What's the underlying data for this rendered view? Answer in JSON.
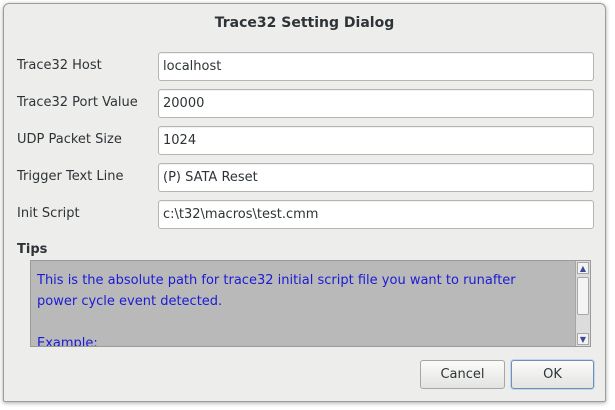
{
  "dialog": {
    "title": "Trace32 Setting Dialog"
  },
  "fields": [
    {
      "label": "Trace32 Host",
      "value": "localhost"
    },
    {
      "label": "Trace32 Port Value",
      "value": "20000"
    },
    {
      "label": "UDP Packet Size",
      "value": "1024"
    },
    {
      "label": "Trigger Text Line",
      "value": "(P) SATA Reset"
    },
    {
      "label": "Init Script",
      "value": "c:\\t32\\macros\\test.cmm"
    }
  ],
  "tips": {
    "label": "Tips",
    "text": "This is the absolute path for trace32 initial script file you want to runafter\npower cycle event detected.\n\nExample:",
    "text_color": "#1b1bd6"
  },
  "buttons": {
    "cancel_label": "Cancel",
    "ok_label": "OK"
  },
  "icons": {
    "scroll_up": "scroll-up-arrow",
    "scroll_down": "scroll-down-arrow"
  }
}
